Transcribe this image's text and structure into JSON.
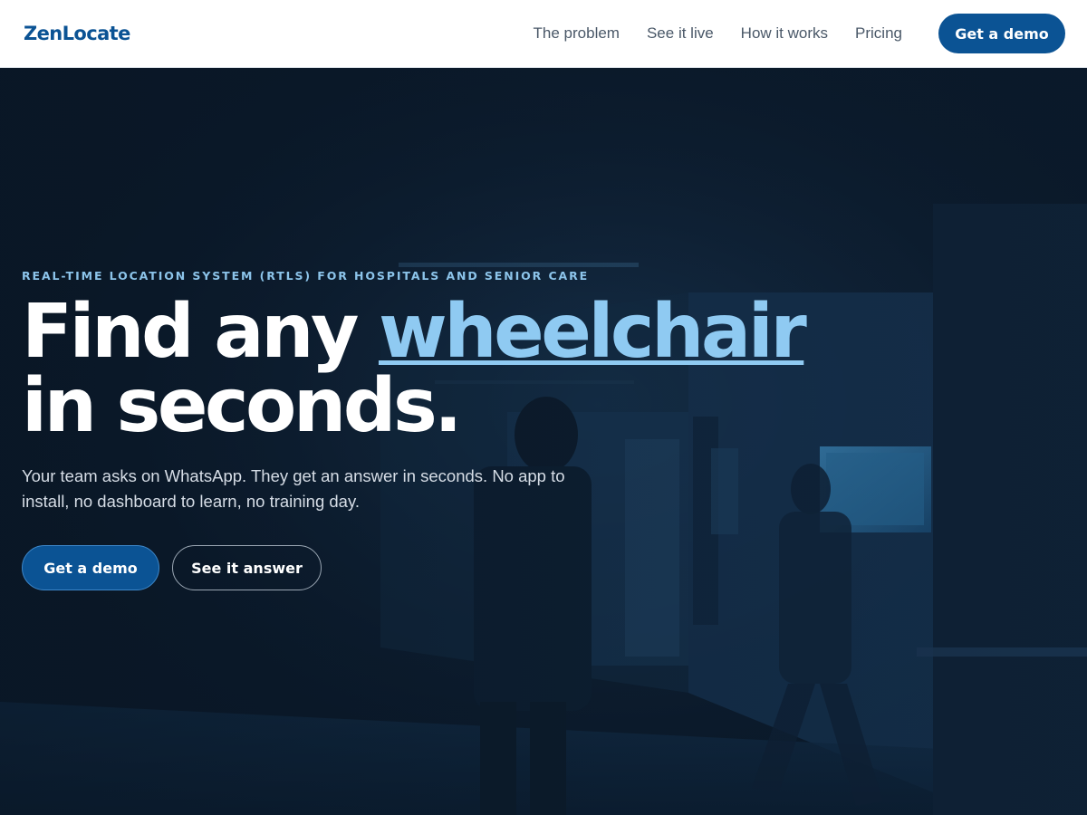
{
  "header": {
    "logo": "ZenLocate",
    "nav": [
      "The problem",
      "See it live",
      "How it works",
      "Pricing"
    ],
    "cta": "Get a demo"
  },
  "hero": {
    "eyebrow": "REAL-TIME LOCATION SYSTEM (RTLS) FOR HOSPITALS AND SENIOR CARE",
    "headline_part1": "Find any ",
    "headline_accent": "wheelchair",
    "headline_part2": "in seconds.",
    "subcopy": "Your team asks on WhatsApp. They get an answer in seconds. No app to install, no dashboard to learn, no training day.",
    "primary_button": "Get a demo",
    "secondary_button": "See it answer"
  },
  "colors": {
    "brand": "#0b5394",
    "accent": "#8fcaf2",
    "eyebrow": "#8cc4ea",
    "hero_bg": "#0d2136"
  }
}
